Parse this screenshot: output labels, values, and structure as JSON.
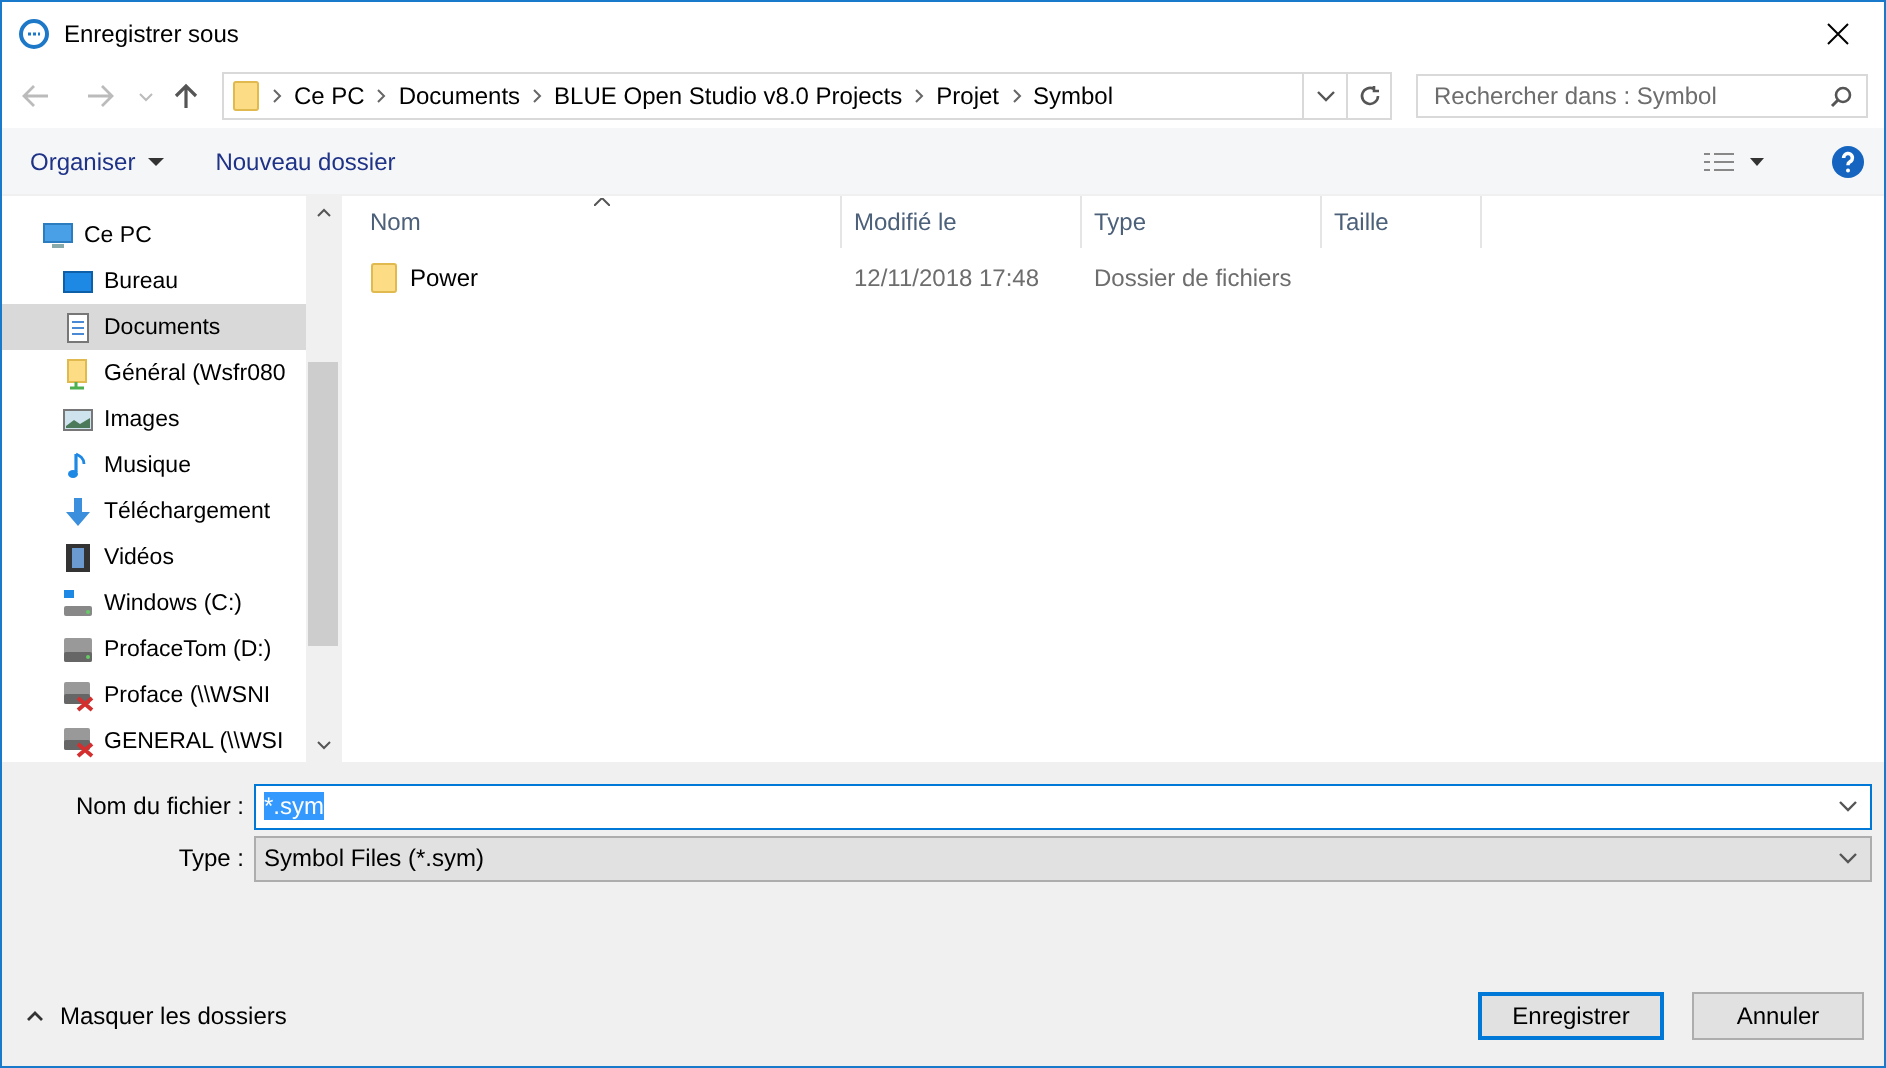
{
  "window": {
    "title": "Enregistrer sous"
  },
  "breadcrumb": [
    "Ce PC",
    "Documents",
    "BLUE Open Studio v8.0 Projects",
    "Projet",
    "Symbol"
  ],
  "search": {
    "placeholder": "Rechercher dans : Symbol"
  },
  "toolbar": {
    "organize": "Organiser",
    "new_folder": "Nouveau dossier"
  },
  "sidebar": {
    "items": [
      {
        "label": "Ce PC",
        "kind": "pc",
        "selected": false,
        "children": [
          {
            "label": "Bureau",
            "kind": "desktop",
            "selected": false
          },
          {
            "label": "Documents",
            "kind": "documents",
            "selected": true
          },
          {
            "label": "Général (Wsfr080",
            "kind": "share",
            "selected": false
          },
          {
            "label": "Images",
            "kind": "images",
            "selected": false
          },
          {
            "label": "Musique",
            "kind": "music",
            "selected": false
          },
          {
            "label": "Téléchargement",
            "kind": "download",
            "selected": false
          },
          {
            "label": "Vidéos",
            "kind": "video",
            "selected": false
          },
          {
            "label": "Windows (C:)",
            "kind": "system-drive",
            "selected": false
          },
          {
            "label": "ProfaceTom (D:)",
            "kind": "drive",
            "selected": false
          },
          {
            "label": "Proface (\\\\WSNI",
            "kind": "network-drive",
            "selected": false
          },
          {
            "label": "GENERAL (\\\\WSI",
            "kind": "network-drive",
            "selected": false
          }
        ]
      }
    ]
  },
  "table": {
    "columns": [
      "Nom",
      "Modifié le",
      "Type",
      "Taille"
    ],
    "rows": [
      {
        "name": "Power",
        "modified": "12/11/2018 17:48",
        "type": "Dossier de fichiers",
        "size": ""
      }
    ]
  },
  "form": {
    "filename_label": "Nom du fichier :",
    "filename": "*.sym",
    "type_label": "Type :",
    "type": "Symbol Files (*.sym)"
  },
  "hide_folders": "Masquer les dossiers",
  "buttons": [
    {
      "label": "Enregistrer",
      "default": true
    },
    {
      "label": "Annuler",
      "default": false
    }
  ]
}
